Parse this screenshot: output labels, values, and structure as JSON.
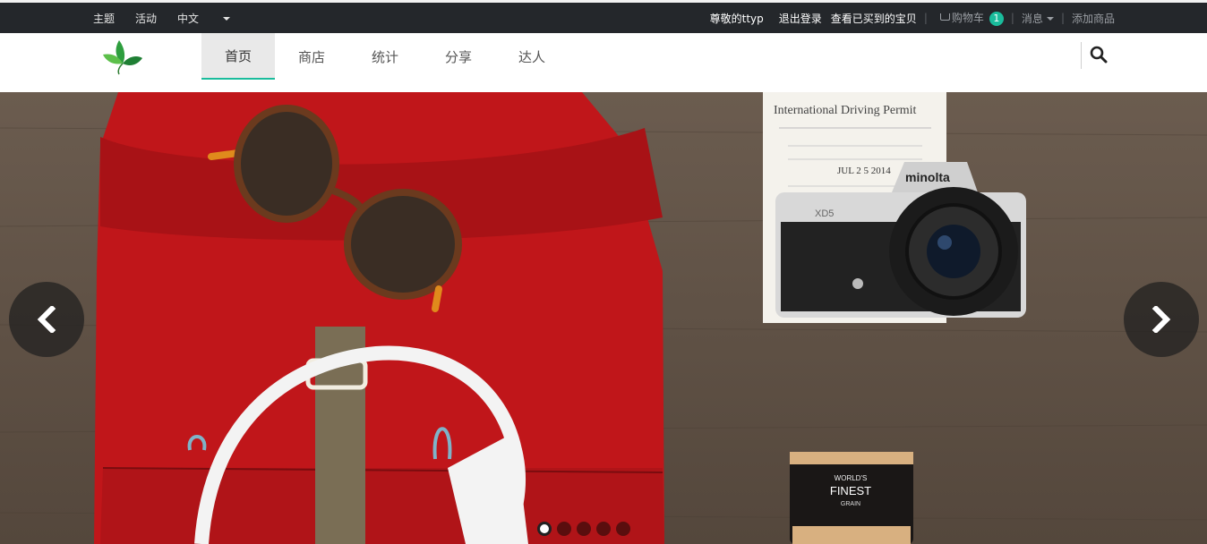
{
  "topbar": {
    "left_items": [
      {
        "label": "主题"
      },
      {
        "label": "活动"
      },
      {
        "label": "中文"
      }
    ],
    "user_greeting": "尊敬的ttyp",
    "logout": "退出登录",
    "purchased": "查看已买到的宝贝",
    "cart_label": "购物车",
    "cart_count": "1",
    "messages": "消息",
    "add_product": "添加商品"
  },
  "nav": {
    "menu": [
      {
        "label": "首页",
        "active": true
      },
      {
        "label": "商店"
      },
      {
        "label": "统计"
      },
      {
        "label": "分享"
      },
      {
        "label": "达人"
      }
    ]
  },
  "banner": {
    "permit_title": "International Driving Permit",
    "permit_date": "JUL 2 5 2014",
    "camera_brand": "minolta",
    "camera_model": "XD5",
    "film_line1": "WORLD'S",
    "film_line2": "FINEST",
    "film_line3": "GRAIN",
    "slide_count": 5,
    "active_slide": 1
  },
  "colors": {
    "accent": "#1abc9c",
    "topbar_bg": "#24272b",
    "bag_red": "#c0161a"
  }
}
